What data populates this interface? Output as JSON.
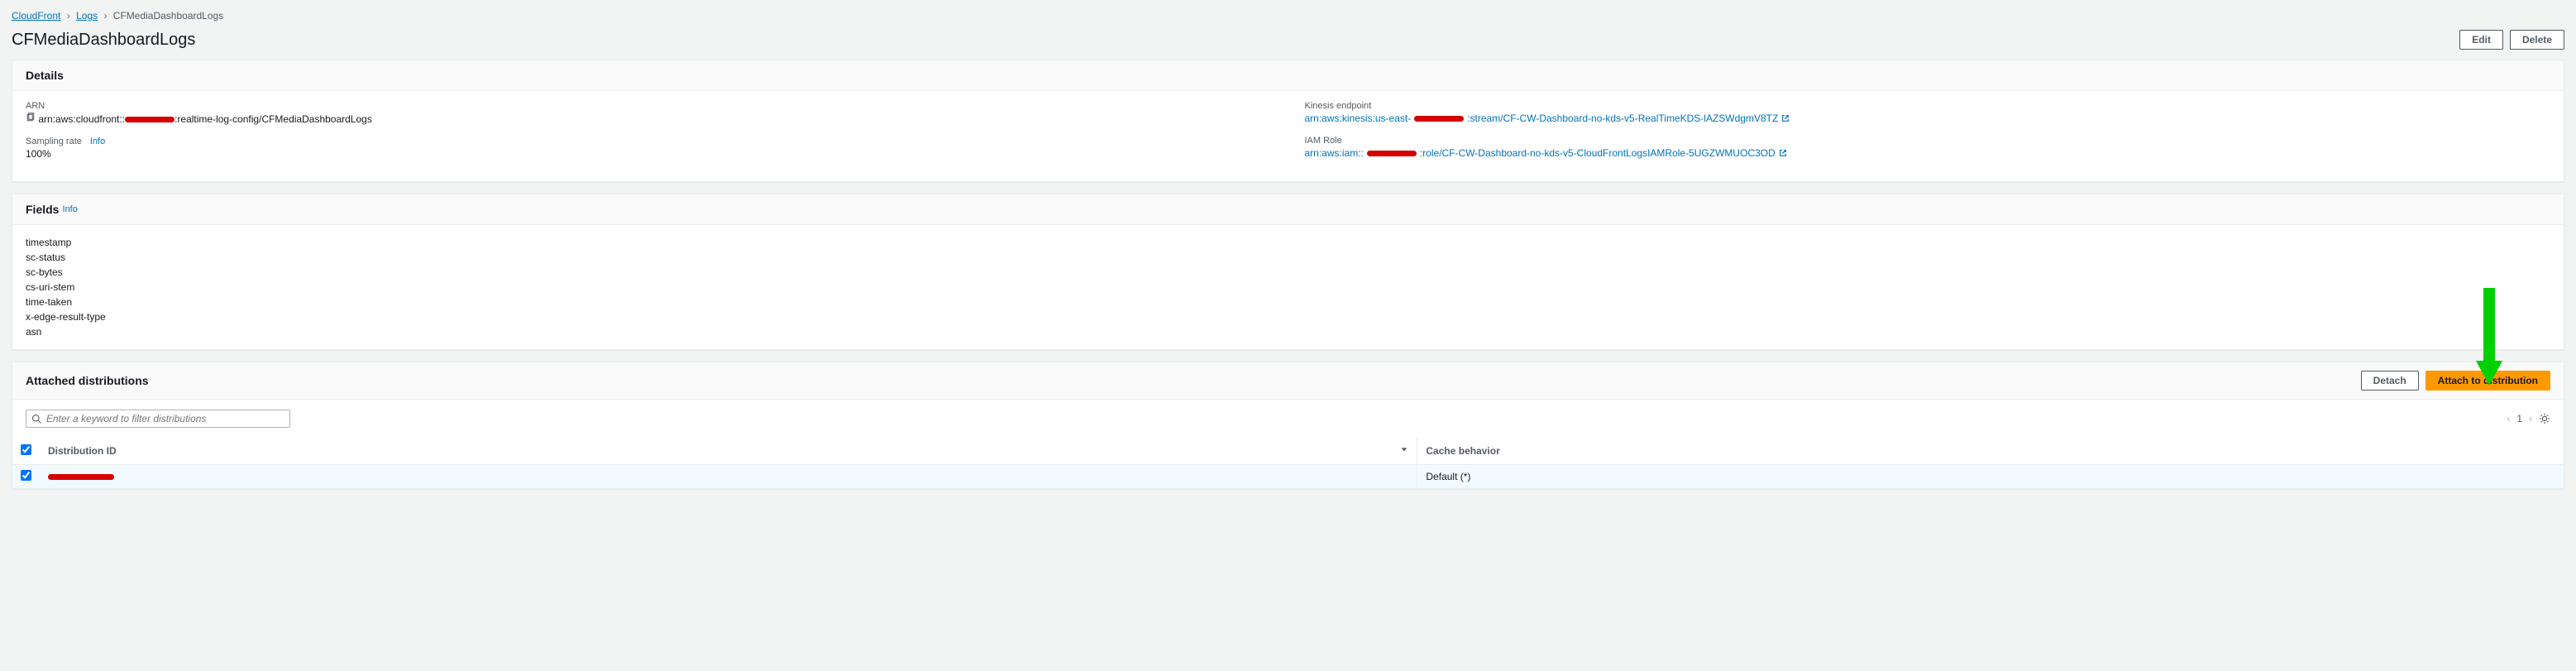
{
  "breadcrumb": {
    "root": "CloudFront",
    "mid": "Logs",
    "current": "CFMediaDashboardLogs"
  },
  "page": {
    "title": "CFMediaDashboardLogs",
    "edit": "Edit",
    "delete": "Delete"
  },
  "details": {
    "heading": "Details",
    "arn_label": "ARN",
    "arn_prefix": "arn:aws:cloudfront::",
    "arn_suffix": ":realtime-log-config/CFMediaDashboardLogs",
    "sampling_label": "Sampling rate",
    "sampling_info": "Info",
    "sampling_value": "100%",
    "kinesis_label": "Kinesis endpoint",
    "kinesis_prefix": "arn:aws:kinesis:us-east-",
    "kinesis_suffix": ":stream/CF-CW-Dashboard-no-kds-v5-RealTimeKDS-lAZSWdgmV8TZ",
    "iam_label": "IAM Role",
    "iam_prefix": "arn:aws:iam::",
    "iam_suffix": ":role/CF-CW-Dashboard-no-kds-v5-CloudFrontLogsIAMRole-5UGZWMUOC3OD"
  },
  "fields": {
    "heading": "Fields",
    "info": "Info",
    "items": [
      "timestamp",
      "sc-status",
      "sc-bytes",
      "cs-uri-stem",
      "time-taken",
      "x-edge-result-type",
      "asn"
    ]
  },
  "attached": {
    "heading": "Attached distributions",
    "detach": "Detach",
    "attach": "Attach to distribution",
    "search_placeholder": "Enter a keyword to filter distributions",
    "page": "1",
    "col_dist": "Distribution ID",
    "col_cache": "Cache behavior",
    "row_cache_value": "Default (*)"
  }
}
